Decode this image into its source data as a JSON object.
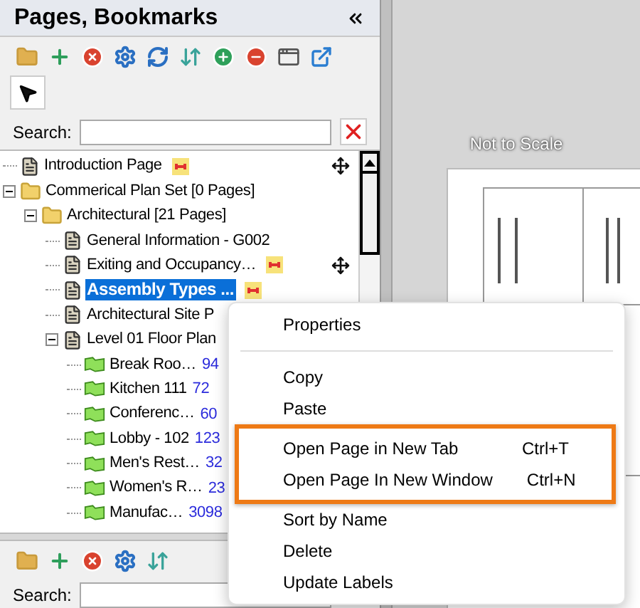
{
  "panel": {
    "title": "Pages, Bookmarks"
  },
  "search": {
    "label": "Search:"
  },
  "tree": [
    {
      "label": "Introduction Page",
      "kind": "page",
      "selected": false,
      "marked": true,
      "movable": true
    },
    {
      "label": "Commerical Plan Set [0 Pages]",
      "kind": "folder",
      "expanded": true,
      "selected": false,
      "marked": false,
      "movable": false,
      "children": [
        {
          "label": "Architectural [21 Pages]",
          "kind": "folder",
          "expanded": true,
          "selected": false,
          "marked": false,
          "movable": false,
          "children": [
            {
              "label": "General Information - G002",
              "kind": "page",
              "selected": false,
              "marked": false,
              "movable": false
            },
            {
              "label": "Exiting and Occupancy…",
              "kind": "page",
              "selected": false,
              "marked": true,
              "movable": true
            },
            {
              "label": "Assembly Types ...",
              "kind": "page",
              "selected": true,
              "marked": true,
              "movable": false
            },
            {
              "label": "Architectural Site P",
              "kind": "page",
              "selected": false,
              "marked": false,
              "movable": false
            },
            {
              "label": "Level 01 Floor Plan",
              "kind": "page",
              "expanded": true,
              "selected": false,
              "marked": false,
              "movable": false,
              "children": [
                {
                  "label": "Break Roo…",
                  "value": "94",
                  "kind": "area",
                  "selected": false,
                  "marked": false,
                  "movable": false
                },
                {
                  "label": "Kitchen 111",
                  "value": "72",
                  "kind": "area",
                  "selected": false,
                  "marked": false,
                  "movable": false
                },
                {
                  "label": "Conferenc…",
                  "value": "60",
                  "kind": "area",
                  "selected": false,
                  "marked": false,
                  "movable": false
                },
                {
                  "label": "Lobby - 102",
                  "value": "123",
                  "kind": "area",
                  "selected": false,
                  "marked": false,
                  "movable": false
                },
                {
                  "label": "Men's Rest…",
                  "value": "32",
                  "kind": "area",
                  "selected": false,
                  "marked": false,
                  "movable": false
                },
                {
                  "label": "Women's R…",
                  "value": "23",
                  "kind": "area",
                  "selected": false,
                  "marked": false,
                  "movable": false
                },
                {
                  "label": "Manufac…",
                  "value": "3098",
                  "kind": "area",
                  "selected": false,
                  "marked": false,
                  "movable": false
                }
              ]
            }
          ]
        }
      ]
    }
  ],
  "bottom_panel": {
    "search": {
      "label": "Search:"
    }
  },
  "canvas": {
    "caption": "Not to Scale"
  },
  "context_menu": [
    {
      "kind": "item",
      "label": "Properties",
      "highlighted": false
    },
    {
      "kind": "separator"
    },
    {
      "kind": "item",
      "label": "Copy",
      "highlighted": false
    },
    {
      "kind": "item",
      "label": "Paste",
      "highlighted": false
    },
    {
      "kind": "item",
      "label": "Open Page in New Tab",
      "shortcut": "Ctrl+T",
      "highlighted": true
    },
    {
      "kind": "item",
      "label": "Open Page In New Window",
      "shortcut": "Ctrl+N",
      "highlighted": true
    },
    {
      "kind": "item",
      "label": "Sort by Name",
      "highlighted": false
    },
    {
      "kind": "item",
      "label": "Delete",
      "highlighted": false
    },
    {
      "kind": "item",
      "label": "Update Labels",
      "highlighted": false
    }
  ]
}
